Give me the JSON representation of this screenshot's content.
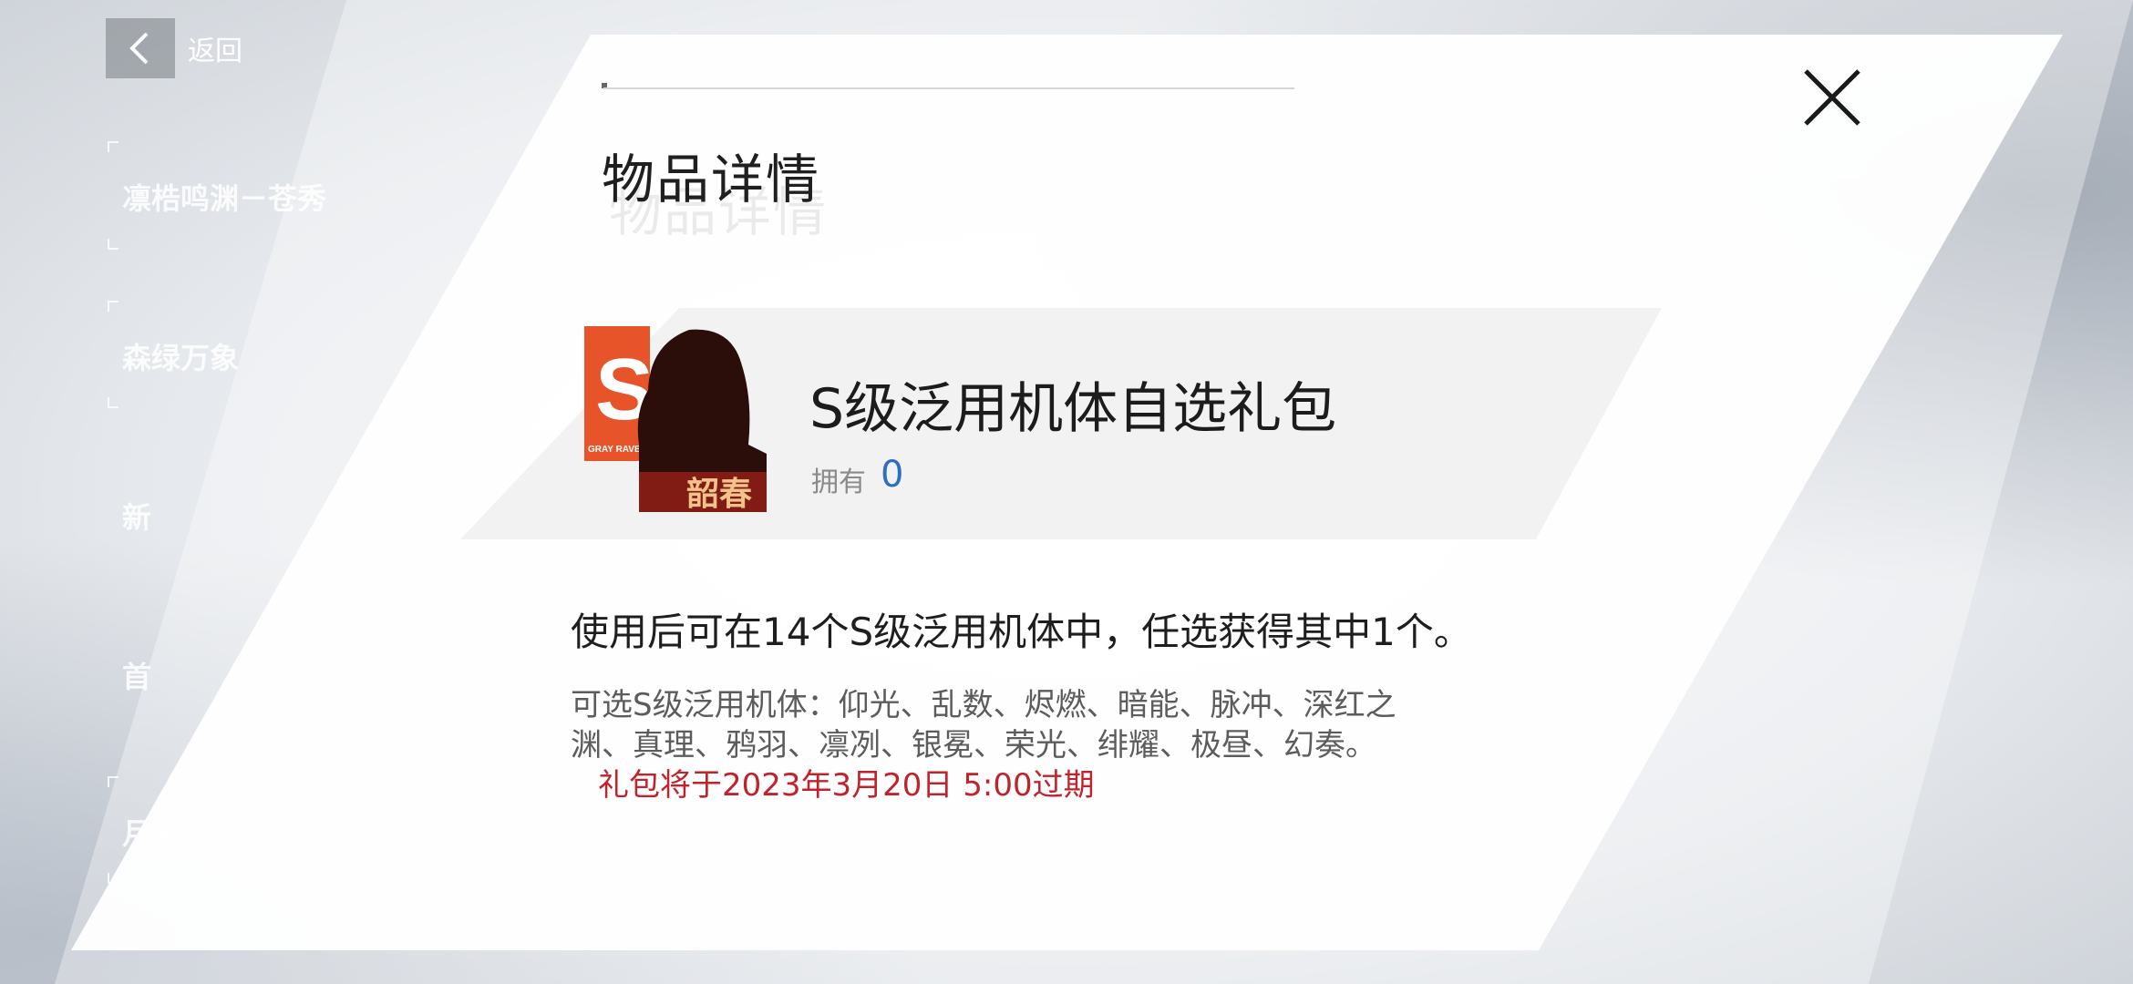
{
  "nav": {
    "back_label": "返回"
  },
  "menu": {
    "items": [
      {
        "label": "凛梏鸣渊－苍秀"
      },
      {
        "label": "森绿万象"
      },
      {
        "label": "新"
      },
      {
        "label": "首"
      },
      {
        "label": "月卡"
      }
    ]
  },
  "dialog": {
    "title": "物品详情",
    "item": {
      "name": "S级泛用机体自选礼包",
      "owned_label": "拥有",
      "owned_value": "0",
      "icon_brand": "GRAY RAVEN",
      "icon_letter": "S",
      "icon_caption": "韶春"
    },
    "description": "使用后可在14个S级泛用机体中，任选获得其中1个。",
    "detail_text": "可选S级泛用机体：仰光、乱数、烬燃、暗能、脉冲、深红之渊、真理、鸦羽、凛冽、银冕、荣光、绯耀、极昼、幻奏。",
    "expire_text": "礼包将于2023年3月20日 5:00过期"
  },
  "colors": {
    "accent_blue": "#2a6fc0",
    "expire_red": "#c0232c",
    "brand_orange": "#e8542a"
  }
}
